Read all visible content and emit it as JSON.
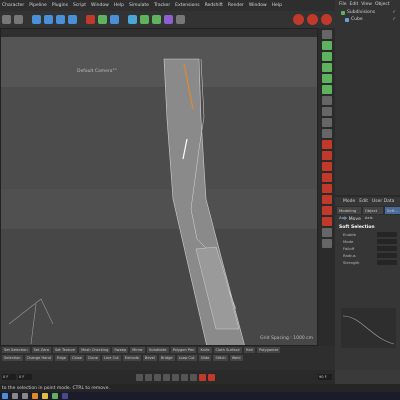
{
  "menubar": {
    "items": [
      "Character",
      "Pipeline",
      "Plugins",
      "Script",
      "Window",
      "Help",
      "Simulate",
      "Tracker",
      "Extensions",
      "Redshift",
      "Render",
      "Window",
      "Help"
    ]
  },
  "viewport": {
    "camera_label": "Default Camera°°",
    "grid_spacing": "Grid Spacing : 1000 cm"
  },
  "object_manager": {
    "menu": [
      "File",
      "Edit",
      "View",
      "Object"
    ],
    "items": [
      {
        "label": "Subdivisions",
        "icon": "subdivision-icon"
      },
      {
        "label": "Cube",
        "icon": "cube-icon"
      }
    ]
  },
  "attribute_manager": {
    "menu": [
      "Mode",
      "Edit",
      "User Data"
    ],
    "tabs": [
      "Modeling Axis",
      "Object Axis",
      "Soft..."
    ],
    "mode": "Move",
    "section": "Soft Selection",
    "rows": [
      "Enable",
      "Mode",
      "Falloff",
      "Radius",
      "Strength"
    ]
  },
  "bottombar": {
    "row1": [
      "Set Selection",
      "Set Zero",
      "Set Texture",
      "Mesh Checking",
      "Sweep",
      "Mirror",
      "Subdivide",
      "Polygon Pen",
      "Knife",
      "Cloth Surface",
      "Hair",
      "Polygonize"
    ],
    "row2": [
      "Selection",
      "Change Hand",
      "Edge",
      "Close",
      "Clone",
      "Line Cut",
      "Extrude",
      "Bevel",
      "Bridge",
      "Loop Cut",
      "Slide",
      "Stitch",
      "Weld"
    ]
  },
  "timeline": {
    "start": "0 F",
    "current": "0 F",
    "end": "90 F"
  },
  "statusbar": {
    "text": "to the selection in point mode. CTRL to remove."
  },
  "colors": {
    "accent_red": "#c0392b",
    "accent_orange": "#e08a2a",
    "accent_green": "#5fb35f"
  }
}
